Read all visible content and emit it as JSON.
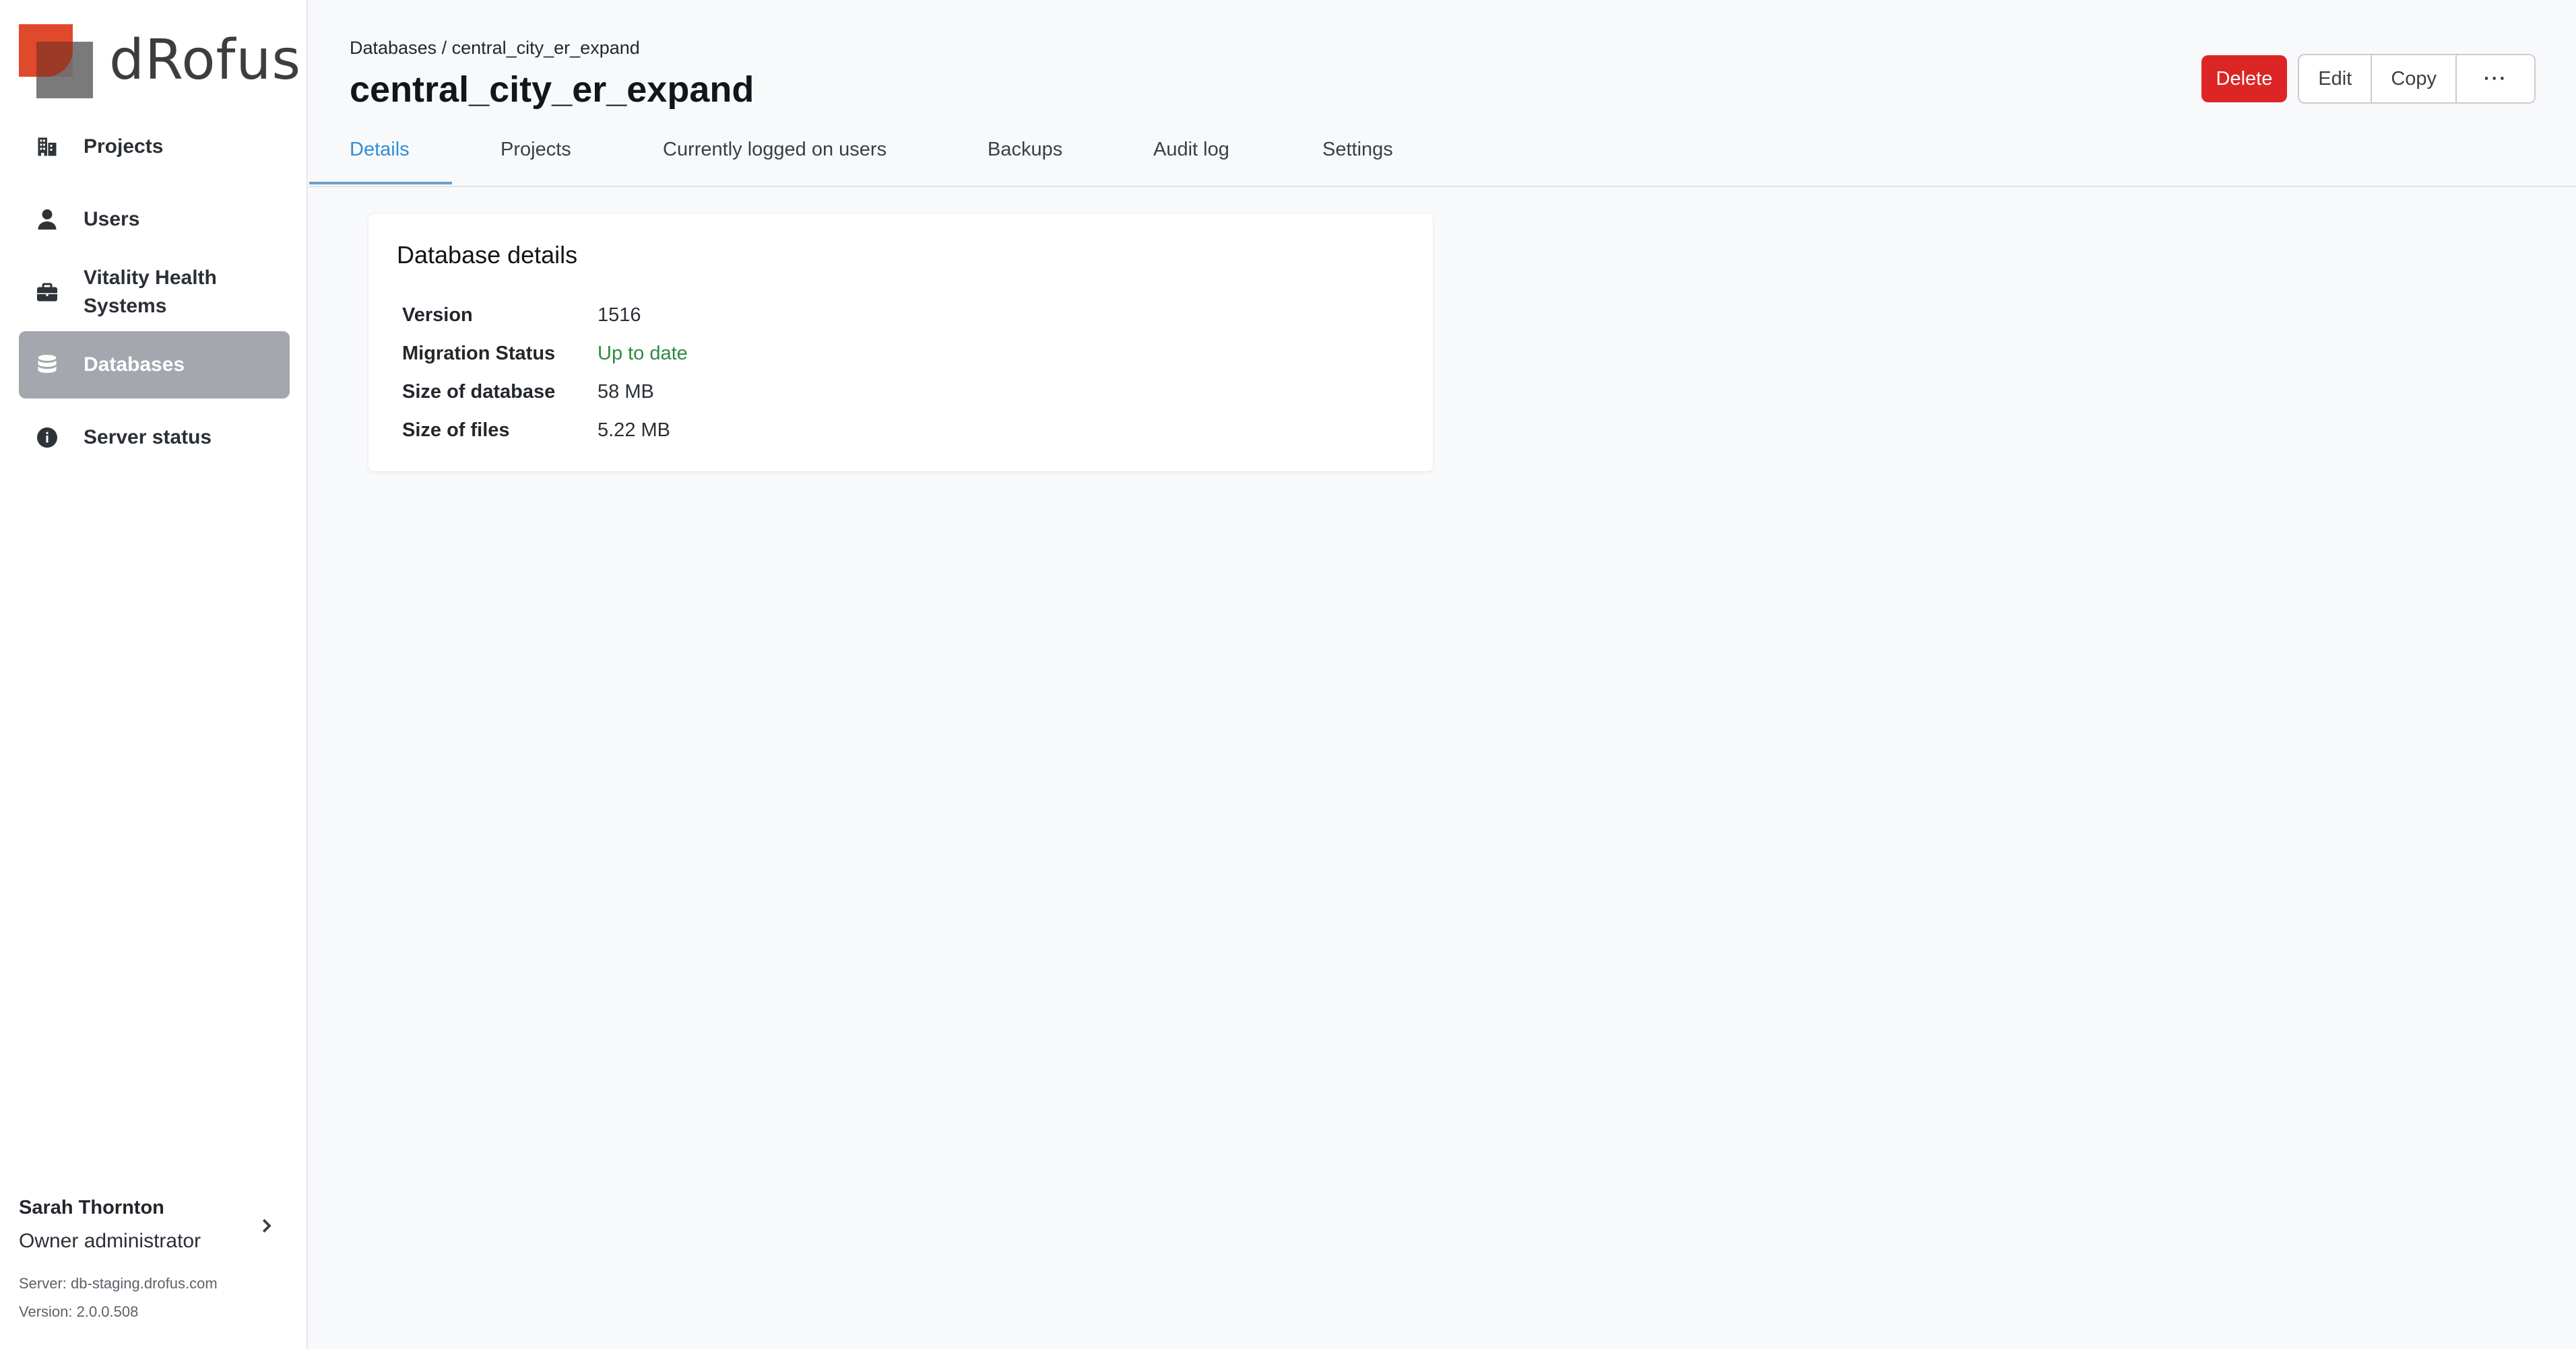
{
  "brand": {
    "logo_text": "dRofus",
    "colors": {
      "accent": "#e0492b",
      "danger": "#dc2626",
      "link": "#2f8fd4",
      "success": "#2e8b3e"
    }
  },
  "sidebar": {
    "items": [
      {
        "label": "Projects",
        "icon": "building-icon",
        "active": false
      },
      {
        "label": "Users",
        "icon": "user-icon",
        "active": false
      },
      {
        "label": "Vitality Health Systems",
        "icon": "briefcase-icon",
        "active": false
      },
      {
        "label": "Databases",
        "icon": "database-icon",
        "active": true
      },
      {
        "label": "Server status",
        "icon": "info-icon",
        "active": false
      }
    ],
    "user": {
      "name": "Sarah Thornton",
      "role": "Owner administrator",
      "server": "Server: db-staging.drofus.com",
      "version": "Version: 2.0.0.508"
    }
  },
  "header": {
    "breadcrumb": "Databases / central_city_er_expand",
    "title": "central_city_er_expand",
    "actions": {
      "delete": "Delete",
      "edit": "Edit",
      "copy": "Copy",
      "more": "···"
    }
  },
  "tabs": [
    {
      "label": "Details",
      "active": true
    },
    {
      "label": "Projects",
      "active": false
    },
    {
      "label": "Currently logged on users",
      "active": false
    },
    {
      "label": "Backups",
      "active": false
    },
    {
      "label": "Audit log",
      "active": false
    },
    {
      "label": "Settings",
      "active": false
    }
  ],
  "details": {
    "heading": "Database details",
    "rows": [
      {
        "key": "Version",
        "value": "1516"
      },
      {
        "key": "Migration Status",
        "value": "Up to date"
      },
      {
        "key": "Size of database",
        "value": "58 MB"
      },
      {
        "key": "Size of files",
        "value": "5.22 MB"
      }
    ]
  }
}
